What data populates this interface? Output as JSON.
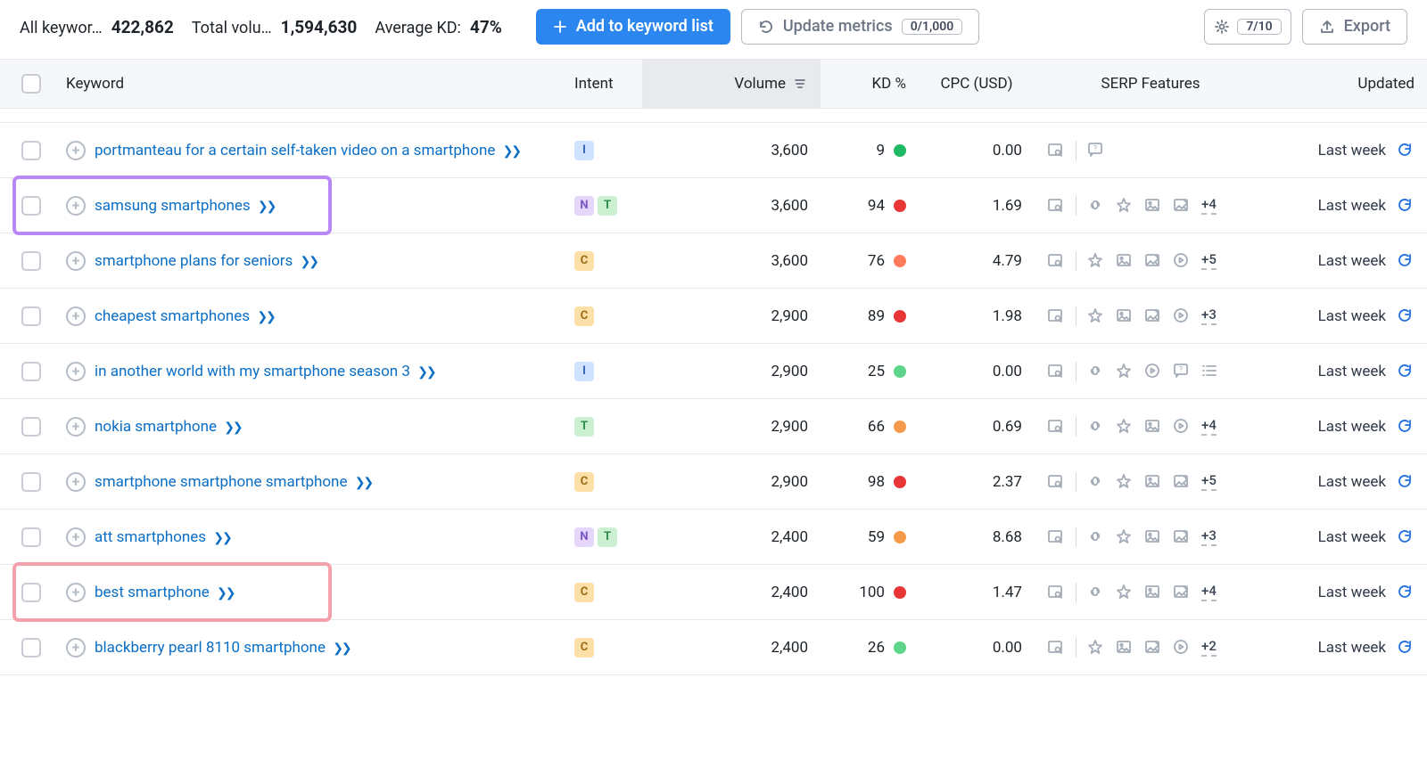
{
  "toolbar": {
    "stats": {
      "all_keywords_label": "All keywor…",
      "all_keywords_value": "422,862",
      "total_volume_label": "Total volu…",
      "total_volume_value": "1,594,630",
      "avg_kd_label": "Average KD:",
      "avg_kd_value": "47%"
    },
    "add_label": "Add to keyword list",
    "update_label": "Update metrics",
    "update_pill": "0/1,000",
    "columns_pill": "7/10",
    "export_label": "Export"
  },
  "columns": {
    "keyword": "Keyword",
    "intent": "Intent",
    "volume": "Volume",
    "kd": "KD %",
    "cpc": "CPC (USD)",
    "serp": "SERP Features",
    "updated": "Updated"
  },
  "rows": [
    {
      "keyword": "portmanteau for a certain self-taken video on a smartphone",
      "intent": [
        "I"
      ],
      "volume": "3,600",
      "kd": "9",
      "kd_color": "kd-green",
      "cpc": "0.00",
      "serp_icons": [
        "serp"
      ],
      "serp_right": [
        "faq"
      ],
      "more": "",
      "updated": "Last week"
    },
    {
      "keyword": "samsung smartphones",
      "intent": [
        "N",
        "T"
      ],
      "volume": "3,600",
      "kd": "94",
      "kd_color": "kd-red",
      "cpc": "1.69",
      "serp_icons": [
        "serp"
      ],
      "serp_right": [
        "link",
        "star",
        "image",
        "carousel"
      ],
      "more": "+4",
      "updated": "Last week",
      "highlight": "purple"
    },
    {
      "keyword": "smartphone plans for seniors",
      "intent": [
        "C"
      ],
      "volume": "3,600",
      "kd": "76",
      "kd_color": "kd-orange2",
      "cpc": "4.79",
      "serp_icons": [
        "serp"
      ],
      "serp_right": [
        "star",
        "image",
        "carousel",
        "video"
      ],
      "more": "+5",
      "updated": "Last week"
    },
    {
      "keyword": "cheapest smartphones",
      "intent": [
        "C"
      ],
      "volume": "2,900",
      "kd": "89",
      "kd_color": "kd-red",
      "cpc": "1.98",
      "serp_icons": [
        "serp"
      ],
      "serp_right": [
        "star",
        "image",
        "carousel",
        "video"
      ],
      "more": "+3",
      "updated": "Last week"
    },
    {
      "keyword": "in another world with my smartphone season 3",
      "intent": [
        "I"
      ],
      "volume": "2,900",
      "kd": "25",
      "kd_color": "kd-green2",
      "cpc": "0.00",
      "serp_icons": [
        "serp"
      ],
      "serp_right": [
        "link",
        "star",
        "video",
        "faq",
        "list"
      ],
      "more": "",
      "updated": "Last week"
    },
    {
      "keyword": "nokia smartphone",
      "intent": [
        "T"
      ],
      "volume": "2,900",
      "kd": "66",
      "kd_color": "kd-orange",
      "cpc": "0.69",
      "serp_icons": [
        "serp"
      ],
      "serp_right": [
        "link",
        "star",
        "image",
        "video"
      ],
      "more": "+4",
      "updated": "Last week"
    },
    {
      "keyword": "smartphone smartphone smartphone",
      "intent": [
        "C"
      ],
      "volume": "2,900",
      "kd": "98",
      "kd_color": "kd-red",
      "cpc": "2.37",
      "serp_icons": [
        "serp"
      ],
      "serp_right": [
        "link",
        "star",
        "image",
        "carousel"
      ],
      "more": "+5",
      "updated": "Last week"
    },
    {
      "keyword": "att smartphones",
      "intent": [
        "N",
        "T"
      ],
      "volume": "2,400",
      "kd": "59",
      "kd_color": "kd-orange",
      "cpc": "8.68",
      "serp_icons": [
        "serp"
      ],
      "serp_right": [
        "link",
        "star",
        "image",
        "carousel"
      ],
      "more": "+3",
      "updated": "Last week"
    },
    {
      "keyword": "best smartphone",
      "intent": [
        "C"
      ],
      "volume": "2,400",
      "kd": "100",
      "kd_color": "kd-red",
      "cpc": "1.47",
      "serp_icons": [
        "serp"
      ],
      "serp_right": [
        "link",
        "star",
        "image",
        "carousel"
      ],
      "more": "+4",
      "updated": "Last week",
      "highlight": "pink"
    },
    {
      "keyword": "blackberry pearl 8110 smartphone",
      "intent": [
        "C"
      ],
      "volume": "2,400",
      "kd": "26",
      "kd_color": "kd-green2",
      "cpc": "0.00",
      "serp_icons": [
        "serp"
      ],
      "serp_right": [
        "star",
        "image",
        "carousel",
        "video"
      ],
      "more": "+2",
      "updated": "Last week"
    }
  ]
}
